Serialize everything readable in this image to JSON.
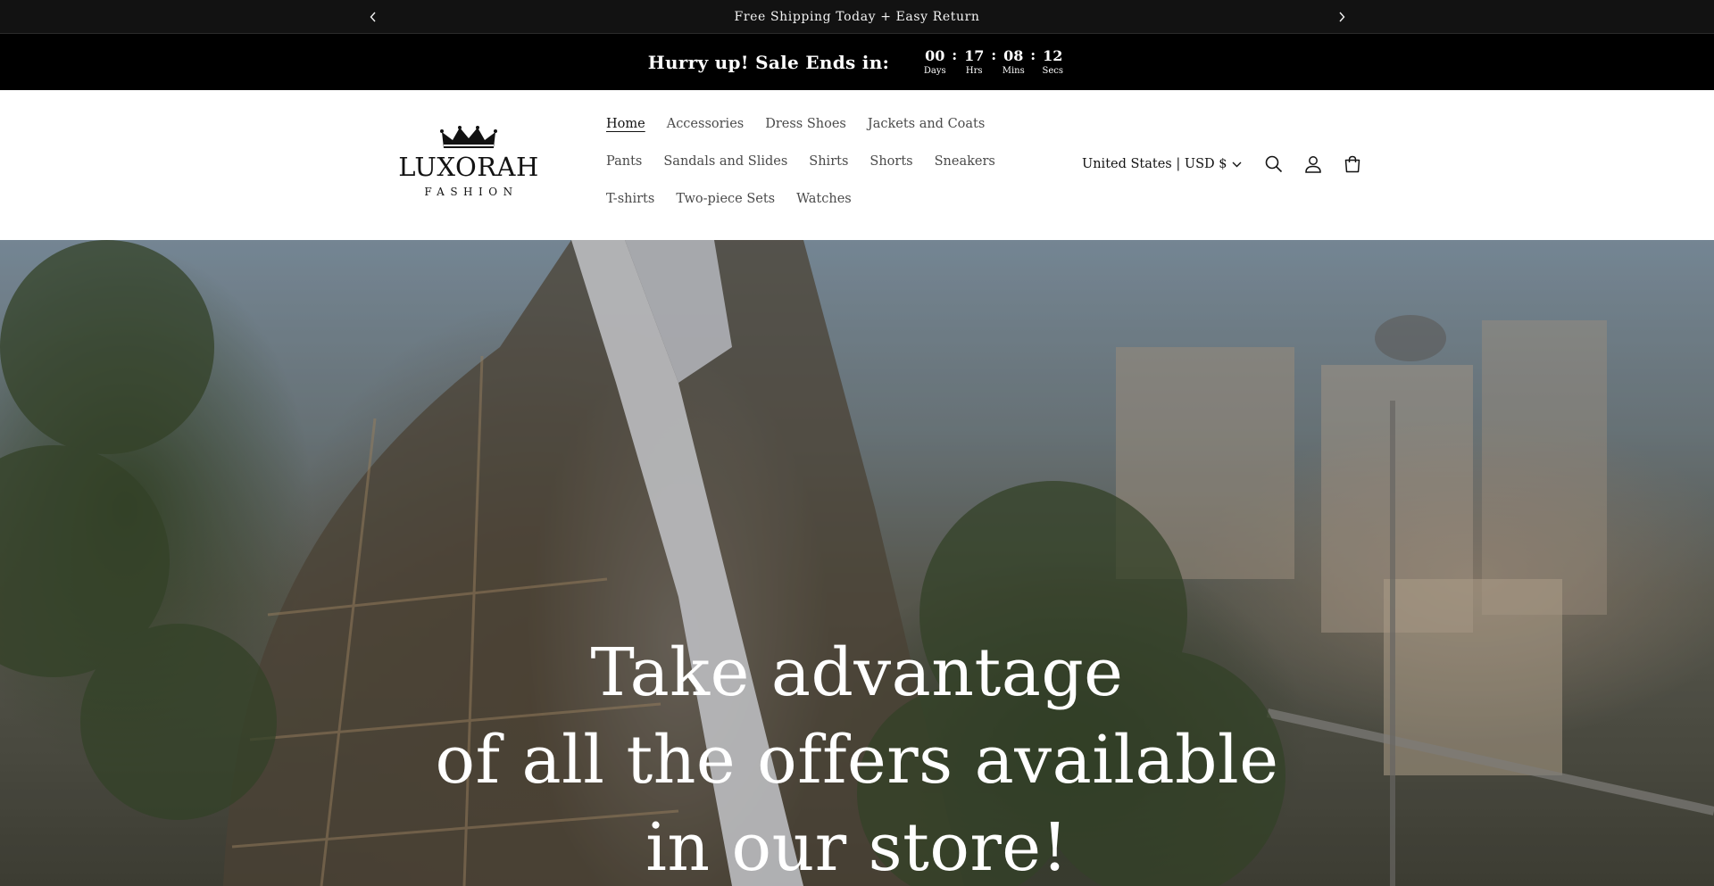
{
  "announcement": {
    "message": "Free Shipping Today + Easy Return",
    "prev_icon": "chevron-left-icon",
    "next_icon": "chevron-right-icon"
  },
  "countdown": {
    "label": "Hurry up! Sale Ends in:",
    "units": [
      {
        "value": "00",
        "label": "Days"
      },
      {
        "value": "17",
        "label": "Hrs"
      },
      {
        "value": "08",
        "label": "Mins"
      },
      {
        "value": "12",
        "label": "Secs"
      }
    ],
    "separator": ":"
  },
  "logo": {
    "brand": "LUXORAH",
    "tagline": "FASHION",
    "icon": "crown-icon"
  },
  "nav": {
    "items": [
      {
        "label": "Home",
        "active": true
      },
      {
        "label": "Accessories"
      },
      {
        "label": "Dress Shoes"
      },
      {
        "label": "Jackets and Coats"
      },
      {
        "label": "Pants"
      },
      {
        "label": "Sandals and Slides"
      },
      {
        "label": "Shirts"
      },
      {
        "label": "Shorts"
      },
      {
        "label": "Sneakers"
      },
      {
        "label": "T-shirts"
      },
      {
        "label": "Two-piece Sets"
      },
      {
        "label": "Watches"
      }
    ]
  },
  "header_tools": {
    "locale": "United States | USD $",
    "icons": [
      "search-icon",
      "account-icon",
      "cart-icon"
    ]
  },
  "hero": {
    "line1": "Take advantage",
    "line2": "of all the offers available",
    "line3": "in our store!"
  },
  "colors": {
    "announcement_bg": "#121212",
    "countdown_bg": "#000000",
    "header_bg": "#ffffff",
    "text": "#121212",
    "hero_text": "#ffffff"
  }
}
